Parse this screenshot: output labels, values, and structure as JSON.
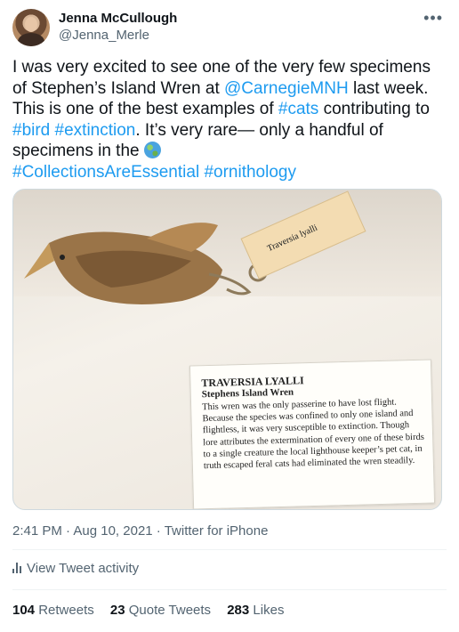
{
  "author": {
    "name": "Jenna McCullough",
    "handle": "@Jenna_Merle"
  },
  "tweet": {
    "line1": "I was very excited to see one of the very few specimens of Stephen’s Island Wren at ",
    "mention": "@CarnegieMNH",
    "line2": " last week. This is one of the best examples of ",
    "tag_cats": "#cats",
    "line3": " contributing to ",
    "tag_bird": "#bird",
    "space": " ",
    "tag_extinction": "#extinction",
    "line4": ". It’s very rare— only a handful of specimens in the ",
    "tag_collections": "#CollectionsAreEssential",
    "tag_ornithology": "#ornithology"
  },
  "photo": {
    "tag_text": "Traversia lyalli",
    "card_title": "TRAVERSIA LYALLI",
    "card_subtitle": "Stephens Island Wren",
    "card_body": "This wren was the only passerine to have lost flight. Because the species was confined to only one island and flightless, it was very susceptible to extinction. Though lore attributes the extermination of every one of these birds to a single creature the local lighthouse keeper’s pet cat, in truth escaped feral cats had eliminated the wren steadily."
  },
  "meta": {
    "time": "2:41 PM",
    "sep": " · ",
    "date": "Aug 10, 2021",
    "source": "Twitter for iPhone"
  },
  "activity_label": "View Tweet activity",
  "stats": {
    "retweets_count": "104",
    "retweets_label": "Retweets",
    "quotes_count": "23",
    "quotes_label": "Quote Tweets",
    "likes_count": "283",
    "likes_label": "Likes"
  },
  "colors": {
    "link": "#1d9bf0",
    "muted": "#536471",
    "text": "#0f1419"
  }
}
